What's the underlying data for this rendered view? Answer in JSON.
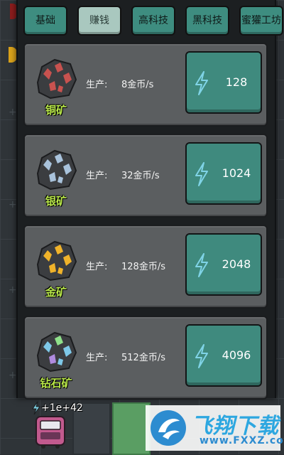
{
  "tabs": [
    {
      "label": "基础",
      "active": false
    },
    {
      "label": "赚钱",
      "active": true
    },
    {
      "label": "高科技",
      "active": false
    },
    {
      "label": "黑科技",
      "active": false
    },
    {
      "label": "蜜獾工坊",
      "active": false
    }
  ],
  "production_label": "生产:",
  "mines": [
    {
      "name": "铜矿",
      "rate": "8金币/s",
      "cost": "128",
      "gem_color": "#c8524f"
    },
    {
      "name": "银矿",
      "rate": "32金币/s",
      "cost": "1024",
      "gem_color": "#a9c3dc"
    },
    {
      "name": "金矿",
      "rate": "128金币/s",
      "cost": "2048",
      "gem_color": "#f0b32a"
    },
    {
      "name": "钻石矿",
      "rate": "512金币/s",
      "cost": "4096",
      "gem_color": "#7ec8e8"
    }
  ],
  "bottom": {
    "value": "+1e+42"
  },
  "watermark": {
    "title": "飞翔下载",
    "subtitle": "www.FXXZ.com"
  },
  "colors": {
    "tab": "#3e8d80",
    "tab_active": "#a9c8bf",
    "button": "#3f8a7e",
    "ore_label": "#b9e84a"
  }
}
